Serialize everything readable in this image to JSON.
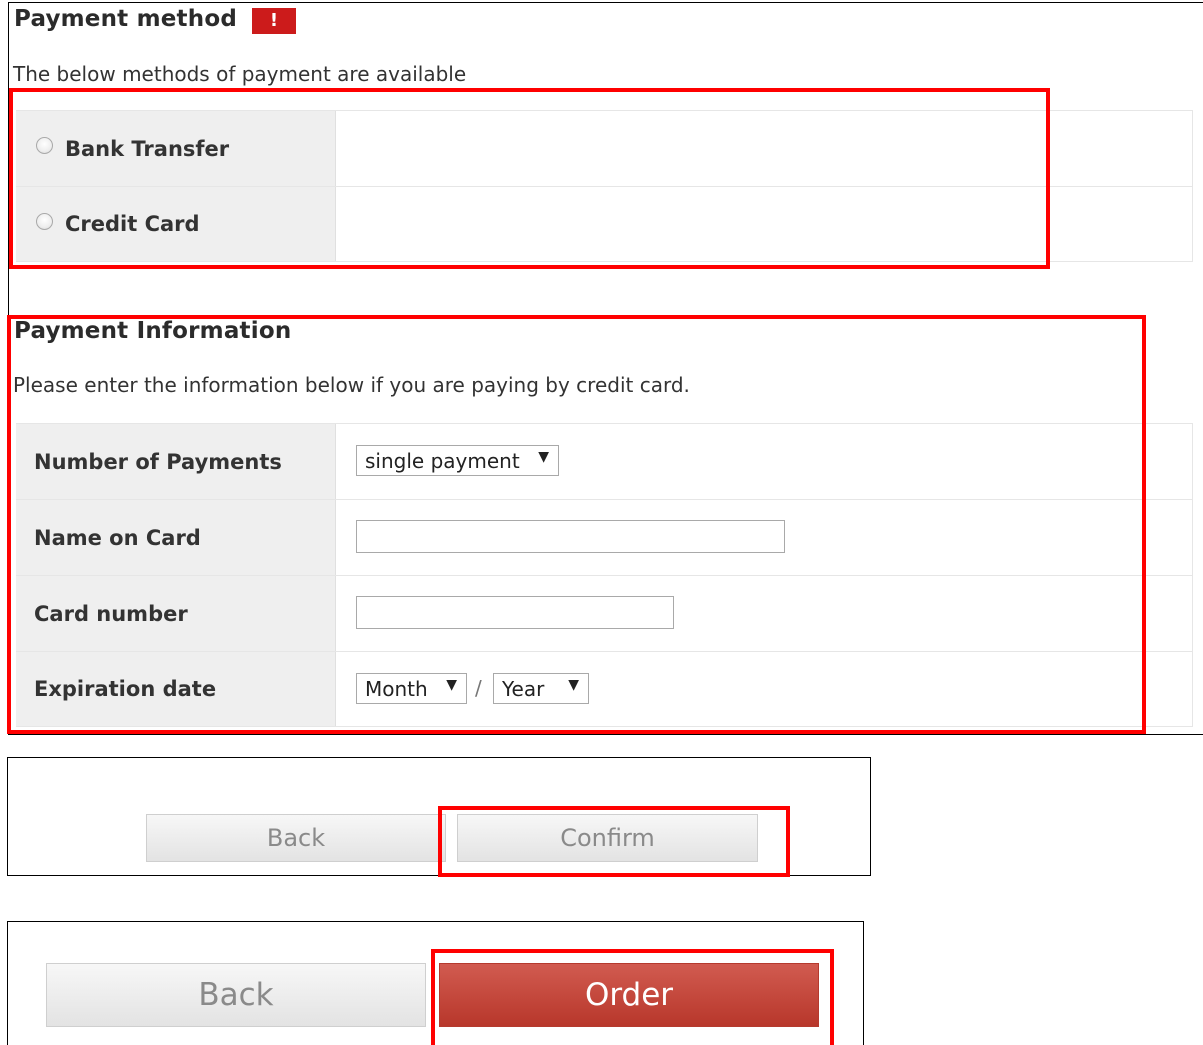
{
  "payment_method": {
    "title": "Payment method",
    "required_badge": "!",
    "description": "The below methods of payment are available",
    "options": [
      {
        "label": "Bank Transfer",
        "selected": false
      },
      {
        "label": "Credit Card",
        "selected": false
      }
    ]
  },
  "payment_info": {
    "title": "Payment Information",
    "description": "Please enter the information below if you are paying by credit card.",
    "number_of_payments": {
      "label": "Number of Payments",
      "value": "single payment"
    },
    "name_on_card": {
      "label": "Name on Card",
      "value": ""
    },
    "card_number": {
      "label": "Card number",
      "value": ""
    },
    "expiration": {
      "label": "Expiration date",
      "month": "Month",
      "separator": "/",
      "year": "Year"
    }
  },
  "confirm_bar": {
    "back_label": "Back",
    "confirm_label": "Confirm"
  },
  "order_bar": {
    "back_label": "Back",
    "order_label": "Order"
  },
  "icons": {
    "dropdown": "▼"
  },
  "colors": {
    "highlight": "#ff0000",
    "required_badge": "#cc1b1b",
    "order_button": "#c1443a",
    "header_cell": "#efefef"
  }
}
